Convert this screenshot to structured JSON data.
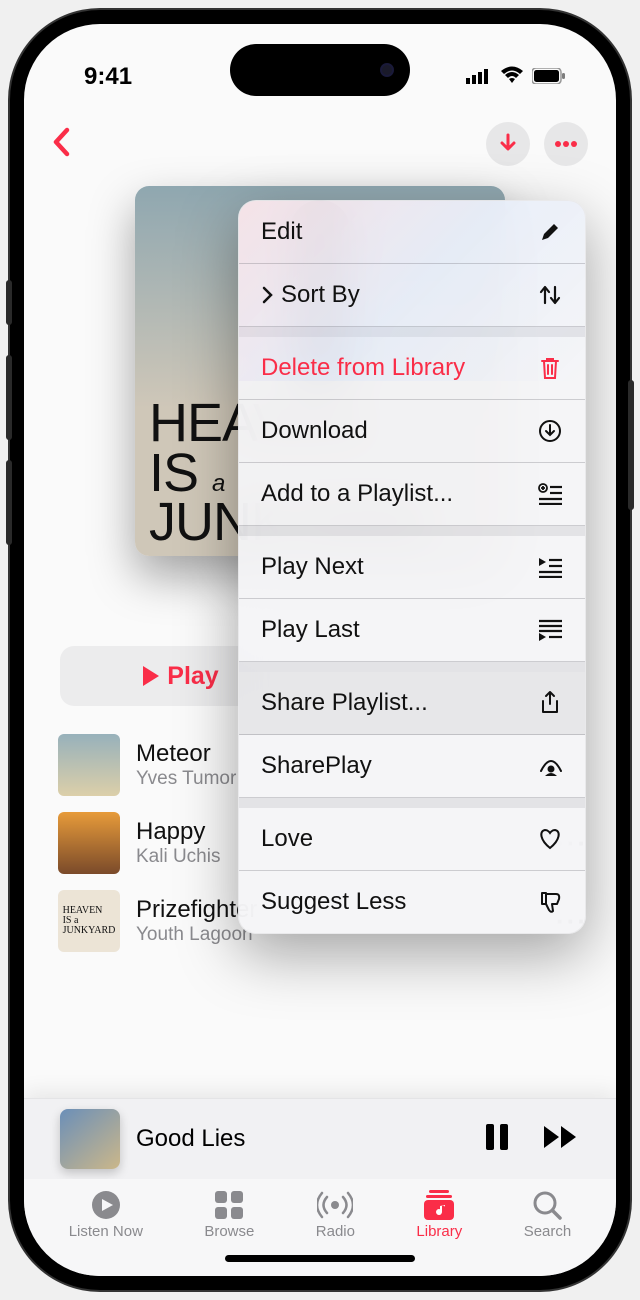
{
  "status": {
    "time": "9:41"
  },
  "album_text": {
    "l1": "HEAVEN",
    "l2": "IS",
    "l2b": "a",
    "l3": "JUNKYARD"
  },
  "play_button": "Play",
  "tracks": [
    {
      "title": "Meteor",
      "artist": "Yves Tumor"
    },
    {
      "title": "Happy",
      "artist": "Kali Uchis"
    },
    {
      "title": "Prizefighter",
      "artist": "Youth Lagoon"
    }
  ],
  "now_playing": {
    "title": "Good Lies"
  },
  "tabs": {
    "listen": "Listen Now",
    "browse": "Browse",
    "radio": "Radio",
    "library": "Library",
    "search": "Search"
  },
  "menu": {
    "edit": "Edit",
    "sort": "Sort By",
    "delete": "Delete from Library",
    "download": "Download",
    "add": "Add to a Playlist...",
    "next": "Play Next",
    "last": "Play Last",
    "share": "Share Playlist...",
    "shareplay": "SharePlay",
    "love": "Love",
    "suggest": "Suggest Less"
  }
}
